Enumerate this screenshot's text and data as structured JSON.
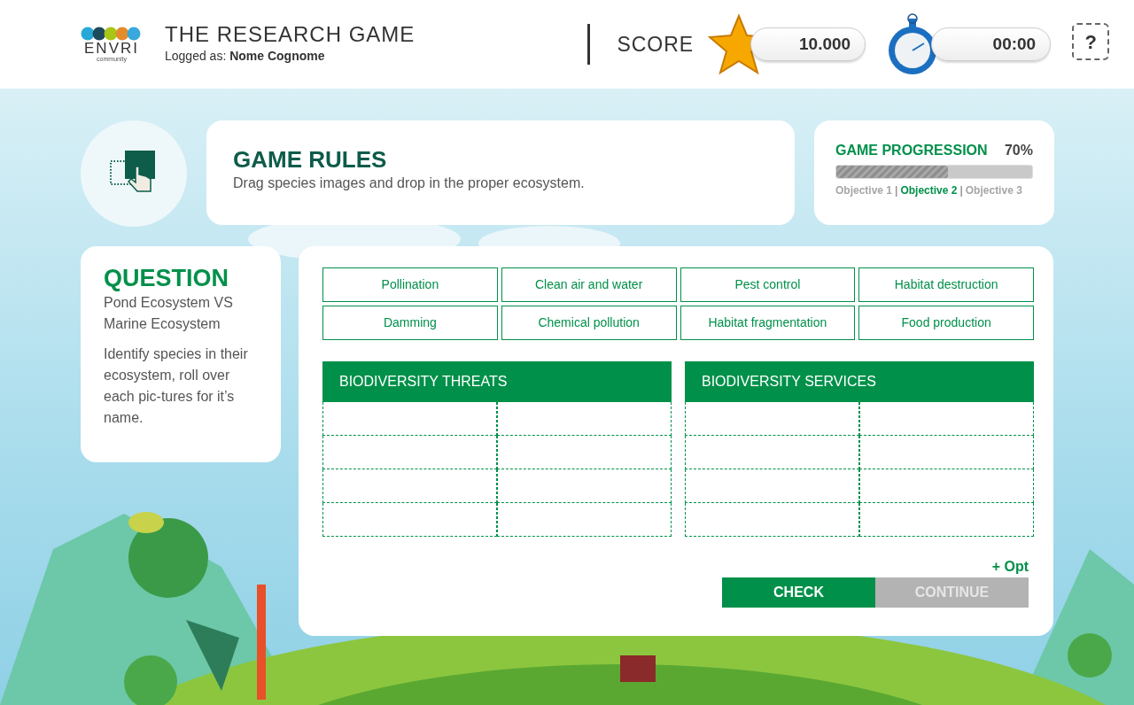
{
  "header": {
    "logo": {
      "name": "ENVRI",
      "tagline": "community"
    },
    "title": "THE RESEARCH GAME",
    "logged_label": "Logged as:",
    "user": "Nome Cognome",
    "score_label": "SCORE",
    "score": "10.000",
    "timer": "00:00",
    "help": "?"
  },
  "rules": {
    "title": "GAME RULES",
    "text": "Drag species images and drop in the proper ecosystem."
  },
  "progression": {
    "title": "GAME PROGRESSION",
    "percent": "70%",
    "level": 0.57,
    "separator": "|",
    "objectives": [
      {
        "label": "Objective 1",
        "selected": false
      },
      {
        "label": "Objective 2",
        "selected": true
      },
      {
        "label": "Objective 3",
        "selected": false
      }
    ]
  },
  "question": {
    "title": "QUESTION",
    "subtitle": "Pond Ecosystem VS Marine Ecosystem",
    "text": "Identify species in their ecosystem, roll over each pic-tures for it’s name."
  },
  "tiles": [
    "Pollination",
    "Clean air and water",
    "Pest control",
    "Habitat destruction",
    "Damming",
    "Chemical pollution",
    "Habitat fragmentation",
    "Food production"
  ],
  "categories": [
    {
      "title": "BIODIVERSITY THREATS"
    },
    {
      "title": "BIODIVERSITY SERVICES"
    }
  ],
  "bonus": "+ Opt",
  "buttons": [
    {
      "label": "CHECK",
      "disabled": false
    },
    {
      "label": "CONTINUE",
      "disabled": true
    }
  ]
}
